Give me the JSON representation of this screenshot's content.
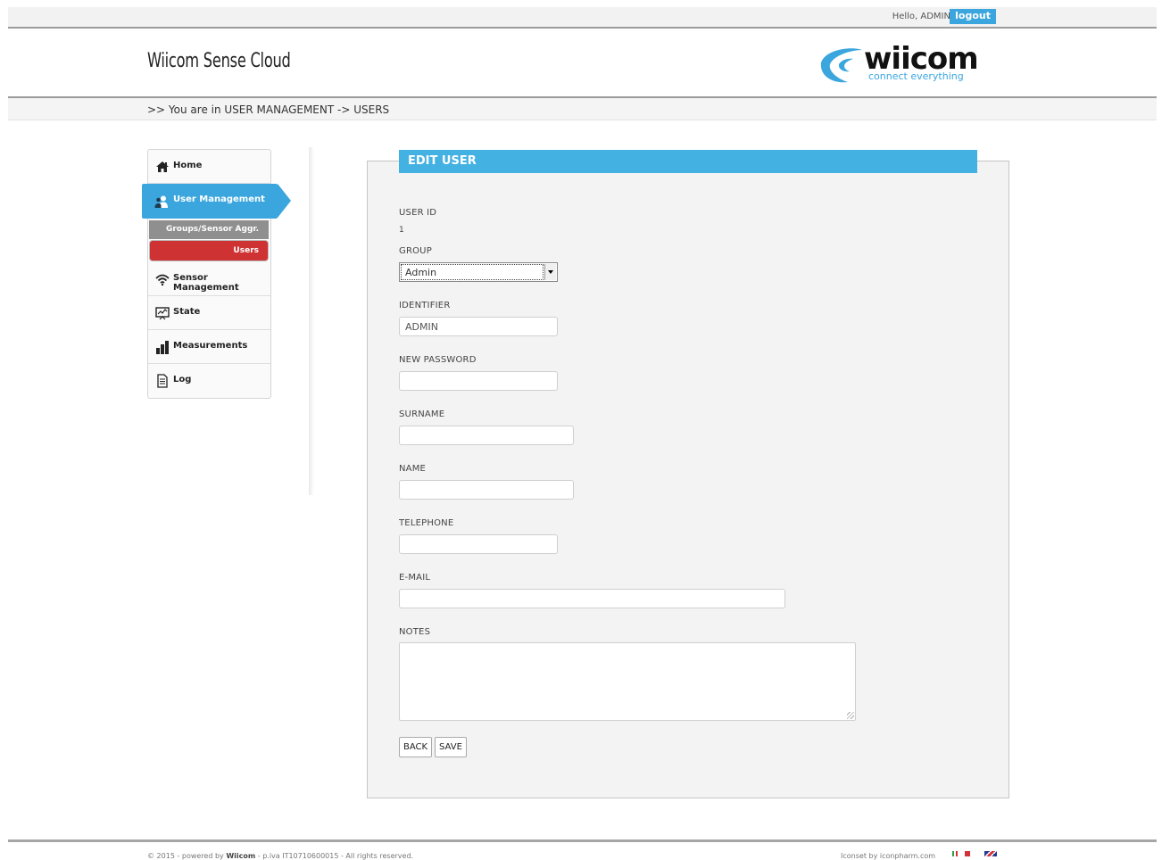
{
  "header": {
    "greeting": "Hello,  ADMIN",
    "logout_label": "logout",
    "app_title": "Wiicom Sense Cloud",
    "logo_word": "wiicom",
    "logo_tagline": "connect everything"
  },
  "breadcrumb": ">> You are in USER MANAGEMENT -> USERS",
  "sidebar": {
    "items": [
      {
        "label": "Home",
        "icon": "home-icon"
      },
      {
        "label": "User Management",
        "icon": "users-icon"
      },
      {
        "label": "Sensor Management",
        "icon": "wifi-icon"
      },
      {
        "label": "State",
        "icon": "monitor-chart-icon"
      },
      {
        "label": "Measurements",
        "icon": "bar-chart-icon"
      },
      {
        "label": "Log",
        "icon": "document-icon"
      }
    ],
    "subitems": [
      {
        "label": "Groups/Sensor Aggr."
      },
      {
        "label": "Users"
      }
    ]
  },
  "form": {
    "title": "EDIT USER",
    "user_id_label": "USER ID",
    "user_id_value": "1",
    "group_label": "GROUP",
    "group_value": "Admin",
    "identifier_label": "IDENTIFIER",
    "identifier_value": "ADMIN",
    "new_password_label": "NEW PASSWORD",
    "new_password_value": "",
    "surname_label": "SURNAME",
    "surname_value": "",
    "name_label": "NAME",
    "name_value": "",
    "telephone_label": "TELEPHONE",
    "telephone_value": "",
    "email_label": "E-MAIL",
    "email_value": "",
    "notes_label": "NOTES",
    "notes_value": "",
    "back_label": "BACK",
    "save_label": "SAVE"
  },
  "footer": {
    "copyright_prefix": "© 2015 - powered by ",
    "copyright_brand": "Wiicom",
    "copyright_suffix": " - p.iva IT10710600015 - All rights reserved.",
    "iconset": "Iconset by iconpharm.com"
  },
  "colors": {
    "accent": "#3aa6dd",
    "panel_header": "#44b1e3",
    "active_subitem": "#cf3232",
    "inactive_subitem": "#8f8f8f"
  }
}
